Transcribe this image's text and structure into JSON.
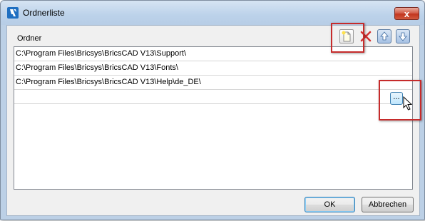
{
  "window": {
    "title": "Ordnerliste",
    "close_glyph": "x"
  },
  "list": {
    "label": "Ordner",
    "rows": [
      "C:\\Program Files\\Bricsys\\BricsCAD V13\\Support\\",
      "C:\\Program Files\\Bricsys\\BricsCAD V13\\Fonts\\",
      "C:\\Program Files\\Bricsys\\BricsCAD V13\\Help\\de_DE\\",
      ""
    ],
    "browse_label": "..."
  },
  "toolbar": {
    "icons": [
      "new-folder-icon",
      "delete-icon",
      "move-up-icon",
      "move-down-icon"
    ]
  },
  "buttons": {
    "ok": "OK",
    "cancel": "Abbrechen"
  },
  "colors": {
    "highlight": "#c62b2b",
    "title_bar": "#bcd2ea",
    "dialog_bg": "#f0f0f0"
  }
}
